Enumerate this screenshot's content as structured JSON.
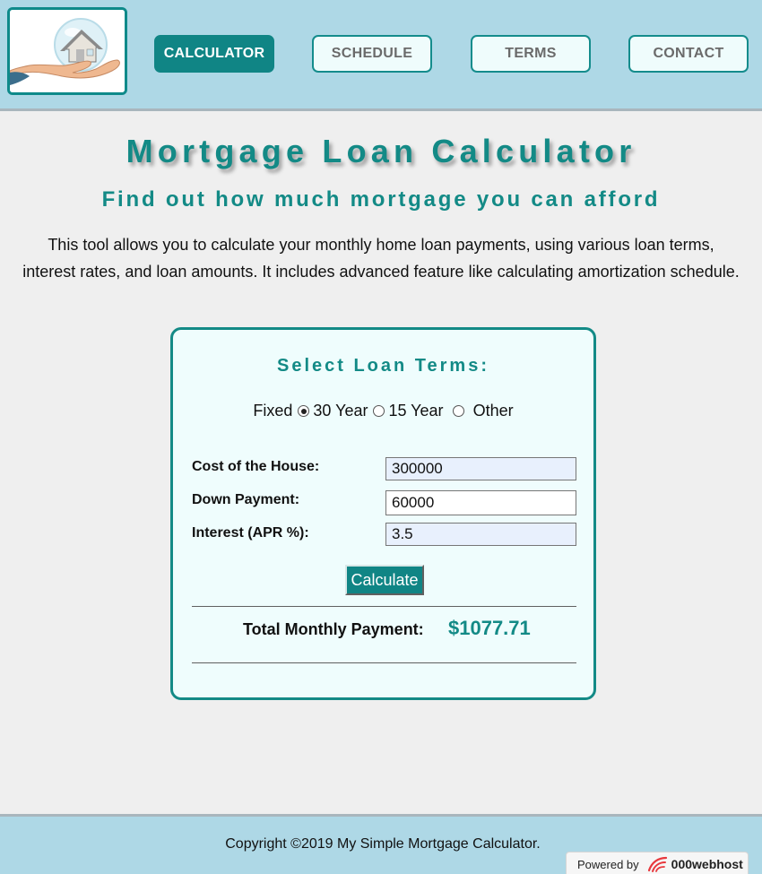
{
  "nav": {
    "items": [
      {
        "label": "CALCULATOR",
        "active": true
      },
      {
        "label": "SCHEDULE",
        "active": false
      },
      {
        "label": "TERMS",
        "active": false
      },
      {
        "label": "CONTACT",
        "active": false
      }
    ]
  },
  "main": {
    "title": "Mortgage Loan Calculator",
    "subtitle": "Find out how much mortgage you can afford",
    "intro": "This tool allows you to calculate your monthly home loan payments, using various loan terms, interest rates, and loan amounts. It includes advanced feature like calculating amortization schedule."
  },
  "calculator": {
    "title": "Select Loan Terms:",
    "term_prefix": "Fixed",
    "terms": [
      {
        "label": "30 Year",
        "selected": true
      },
      {
        "label": "15 Year",
        "selected": false
      },
      {
        "label": "Other",
        "selected": false
      }
    ],
    "fields": {
      "cost": {
        "label": "Cost of the House:",
        "value": "300000"
      },
      "down": {
        "label": "Down Payment:",
        "value": "60000"
      },
      "interest": {
        "label": "Interest (APR %):",
        "value": "3.5"
      }
    },
    "button_label": "Calculate",
    "total_label": "Total Monthly Payment:",
    "total_value": "$1077.71"
  },
  "footer": {
    "copyright": "Copyright ©2019 My Simple Mortgage Calculator.",
    "powered_label": "Powered by",
    "powered_brand": "000webhost"
  },
  "colors": {
    "header_bg": "#aed8e6",
    "accent": "#138a86",
    "page_bg": "#efefef",
    "card_bg": "#effdfd"
  },
  "icons": {
    "logo": "house-in-hand-icon",
    "host_logo": "000webhost-logo-icon"
  }
}
